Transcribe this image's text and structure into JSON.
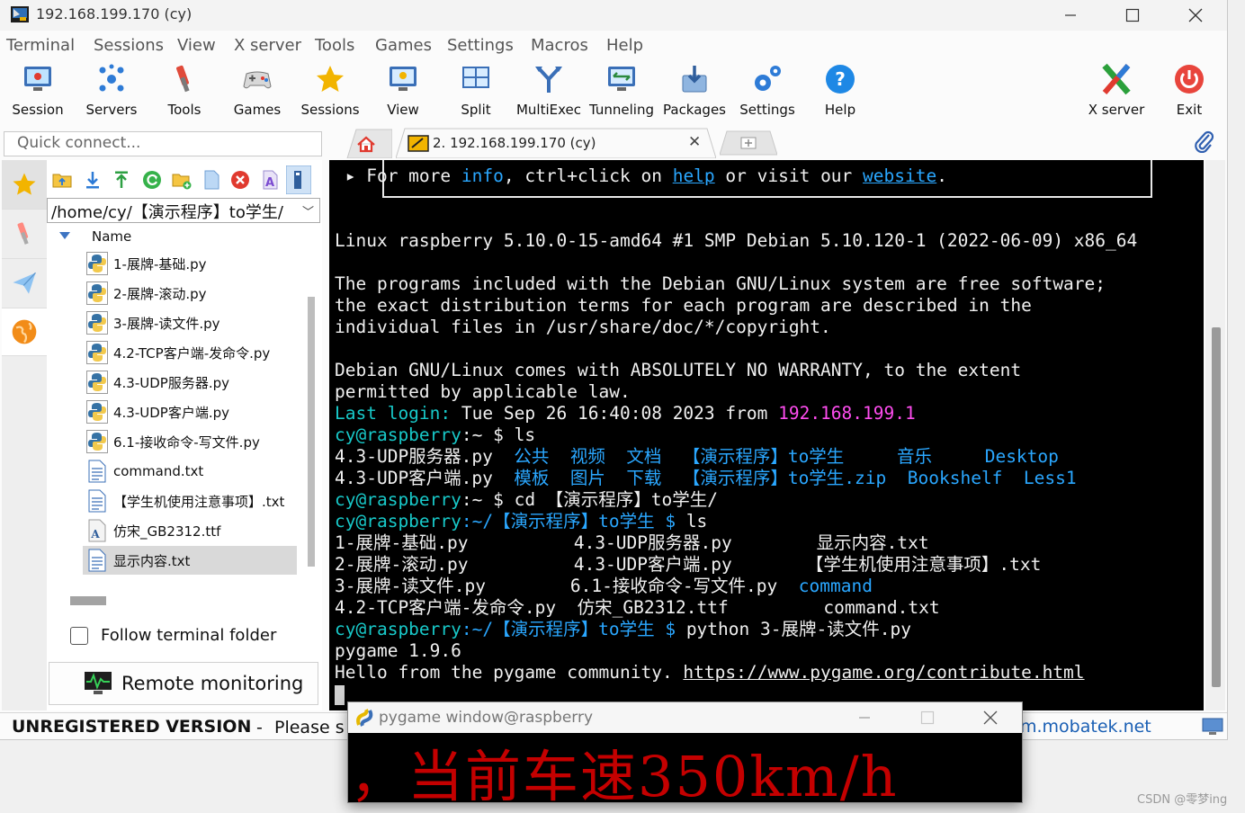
{
  "window": {
    "title": "192.168.199.170 (cy)"
  },
  "menu": [
    "Terminal",
    "Sessions",
    "View",
    "X server",
    "Tools",
    "Games",
    "Settings",
    "Macros",
    "Help"
  ],
  "toolbar": {
    "left": [
      {
        "label": "Session",
        "icon": "session-icon"
      },
      {
        "label": "Servers",
        "icon": "servers-icon"
      },
      {
        "label": "Tools",
        "icon": "tools-icon"
      },
      {
        "label": "Games",
        "icon": "games-icon"
      },
      {
        "label": "Sessions",
        "icon": "star-icon"
      },
      {
        "label": "View",
        "icon": "view-icon"
      },
      {
        "label": "Split",
        "icon": "split-icon"
      },
      {
        "label": "MultiExec",
        "icon": "multiexec-icon"
      },
      {
        "label": "Tunneling",
        "icon": "tunneling-icon"
      },
      {
        "label": "Packages",
        "icon": "packages-icon"
      },
      {
        "label": "Settings",
        "icon": "settings-icon"
      },
      {
        "label": "Help",
        "icon": "help-icon"
      }
    ],
    "right": [
      {
        "label": "X server",
        "icon": "x-server-icon"
      },
      {
        "label": "Exit",
        "icon": "power-icon"
      }
    ]
  },
  "quick_connect": {
    "placeholder": "Quick connect..."
  },
  "tabs": {
    "active_label": "2. 192.168.199.170 (cy)"
  },
  "sftp": {
    "path": "/home/cy/【演示程序】to学生/",
    "column_header": "Name",
    "files": [
      {
        "name": "1-展牌-基础.py",
        "type": "py"
      },
      {
        "name": "2-展牌-滚动.py",
        "type": "py"
      },
      {
        "name": "3-展牌-读文件.py",
        "type": "py"
      },
      {
        "name": "4.2-TCP客户端-发命令.py",
        "type": "py"
      },
      {
        "name": "4.3-UDP服务器.py",
        "type": "py"
      },
      {
        "name": "4.3-UDP客户端.py",
        "type": "py"
      },
      {
        "name": "6.1-接收命令-写文件.py",
        "type": "py"
      },
      {
        "name": "command.txt",
        "type": "txt"
      },
      {
        "name": "【学生机使用注意事项】.txt",
        "type": "txt"
      },
      {
        "name": "仿宋_GB2312.ttf",
        "type": "ttf"
      },
      {
        "name": "显示内容.txt",
        "type": "txt"
      }
    ],
    "selected_index": 10,
    "follow_label": "Follow terminal folder",
    "follow_checked": false,
    "remote_label": "Remote monitoring"
  },
  "terminal": {
    "lines": [
      [
        {
          "t": " ▸ For more "
        },
        {
          "t": "info",
          "c": "bl"
        },
        {
          "t": ", ctrl+click on "
        },
        {
          "t": "help",
          "c": "bl ul"
        },
        {
          "t": " or visit our "
        },
        {
          "t": "website",
          "c": "bl ul"
        },
        {
          "t": "."
        }
      ],
      [],
      [],
      [
        {
          "t": "Linux raspberry 5.10.0-15-amd64 #1 SMP Debian 5.10.120-1 (2022-06-09) x86_64"
        }
      ],
      [],
      [
        {
          "t": "The programs included with the Debian GNU/Linux system are free software;"
        }
      ],
      [
        {
          "t": "the exact distribution terms for each program are described in the"
        }
      ],
      [
        {
          "t": "individual files in /usr/share/doc/*/copyright."
        }
      ],
      [],
      [
        {
          "t": "Debian GNU/Linux comes with ABSOLUTELY NO WARRANTY, to the extent"
        }
      ],
      [
        {
          "t": "permitted by applicable law."
        }
      ],
      [
        {
          "t": "Last login: ",
          "c": "cy"
        },
        {
          "t": "Tue Sep 26 16:40:08 2023 from "
        },
        {
          "t": "192.168.199.1",
          "c": "mag"
        }
      ],
      [
        {
          "t": "cy@raspberry",
          "c": "cy"
        },
        {
          "t": ":~ $ ls"
        }
      ],
      [
        {
          "t": "4.3-UDP服务器.py  "
        },
        {
          "t": "公共  视频  文档  【演示程序】to学生     音乐     Desktop",
          "c": "bl"
        }
      ],
      [
        {
          "t": "4.3-UDP客户端.py  "
        },
        {
          "t": "模板  图片  下载  【演示程序】to学生.zip",
          "c": "bl"
        },
        {
          "t": "  "
        },
        {
          "t": "Bookshelf  Less1",
          "c": "bl"
        }
      ],
      [
        {
          "t": "cy@raspberry",
          "c": "cy"
        },
        {
          "t": ":~ $ cd 【演示程序】to学生/"
        }
      ],
      [
        {
          "t": "cy@raspberry",
          "c": "cy"
        },
        {
          "t": ":~/【演示程序】to学生 $ ",
          "c": "bl"
        },
        {
          "t": "ls"
        }
      ],
      [
        {
          "t": "1-展牌-基础.py          4.3-UDP服务器.py        显示内容.txt"
        }
      ],
      [
        {
          "t": "2-展牌-滚动.py          4.3-UDP客户端.py       【学生机使用注意事项】.txt"
        }
      ],
      [
        {
          "t": "3-展牌-读文件.py        6.1-接收命令-写文件.py  "
        },
        {
          "t": "command",
          "c": "bl"
        }
      ],
      [
        {
          "t": "4.2-TCP客户端-发命令.py  仿宋_GB2312.ttf         command.txt"
        }
      ],
      [
        {
          "t": "cy@raspberry",
          "c": "cy"
        },
        {
          "t": ":~/【演示程序】to学生 $ ",
          "c": "bl"
        },
        {
          "t": "python 3-展牌-读文件.py"
        }
      ],
      [
        {
          "t": "pygame 1.9.6"
        }
      ],
      [
        {
          "t": "Hello from the pygame community. "
        },
        {
          "t": "https://www.pygame.org/contribute.html",
          "c": "ul"
        }
      ]
    ]
  },
  "status": {
    "unregistered": "UNREGISTERED VERSION",
    "separator": "-",
    "please": "Please su",
    "link": "m.mobatek.net"
  },
  "pygame": {
    "title": "pygame window@raspberry",
    "display_text": "，当前车速350km/h"
  },
  "watermark": "CSDN @零梦ing",
  "colors": {
    "terminal_bg": "#000000",
    "prompt": "#18c9c9",
    "dir": "#2aa7ff",
    "ip": "#ff4df0",
    "pygame_text": "#c40000"
  }
}
